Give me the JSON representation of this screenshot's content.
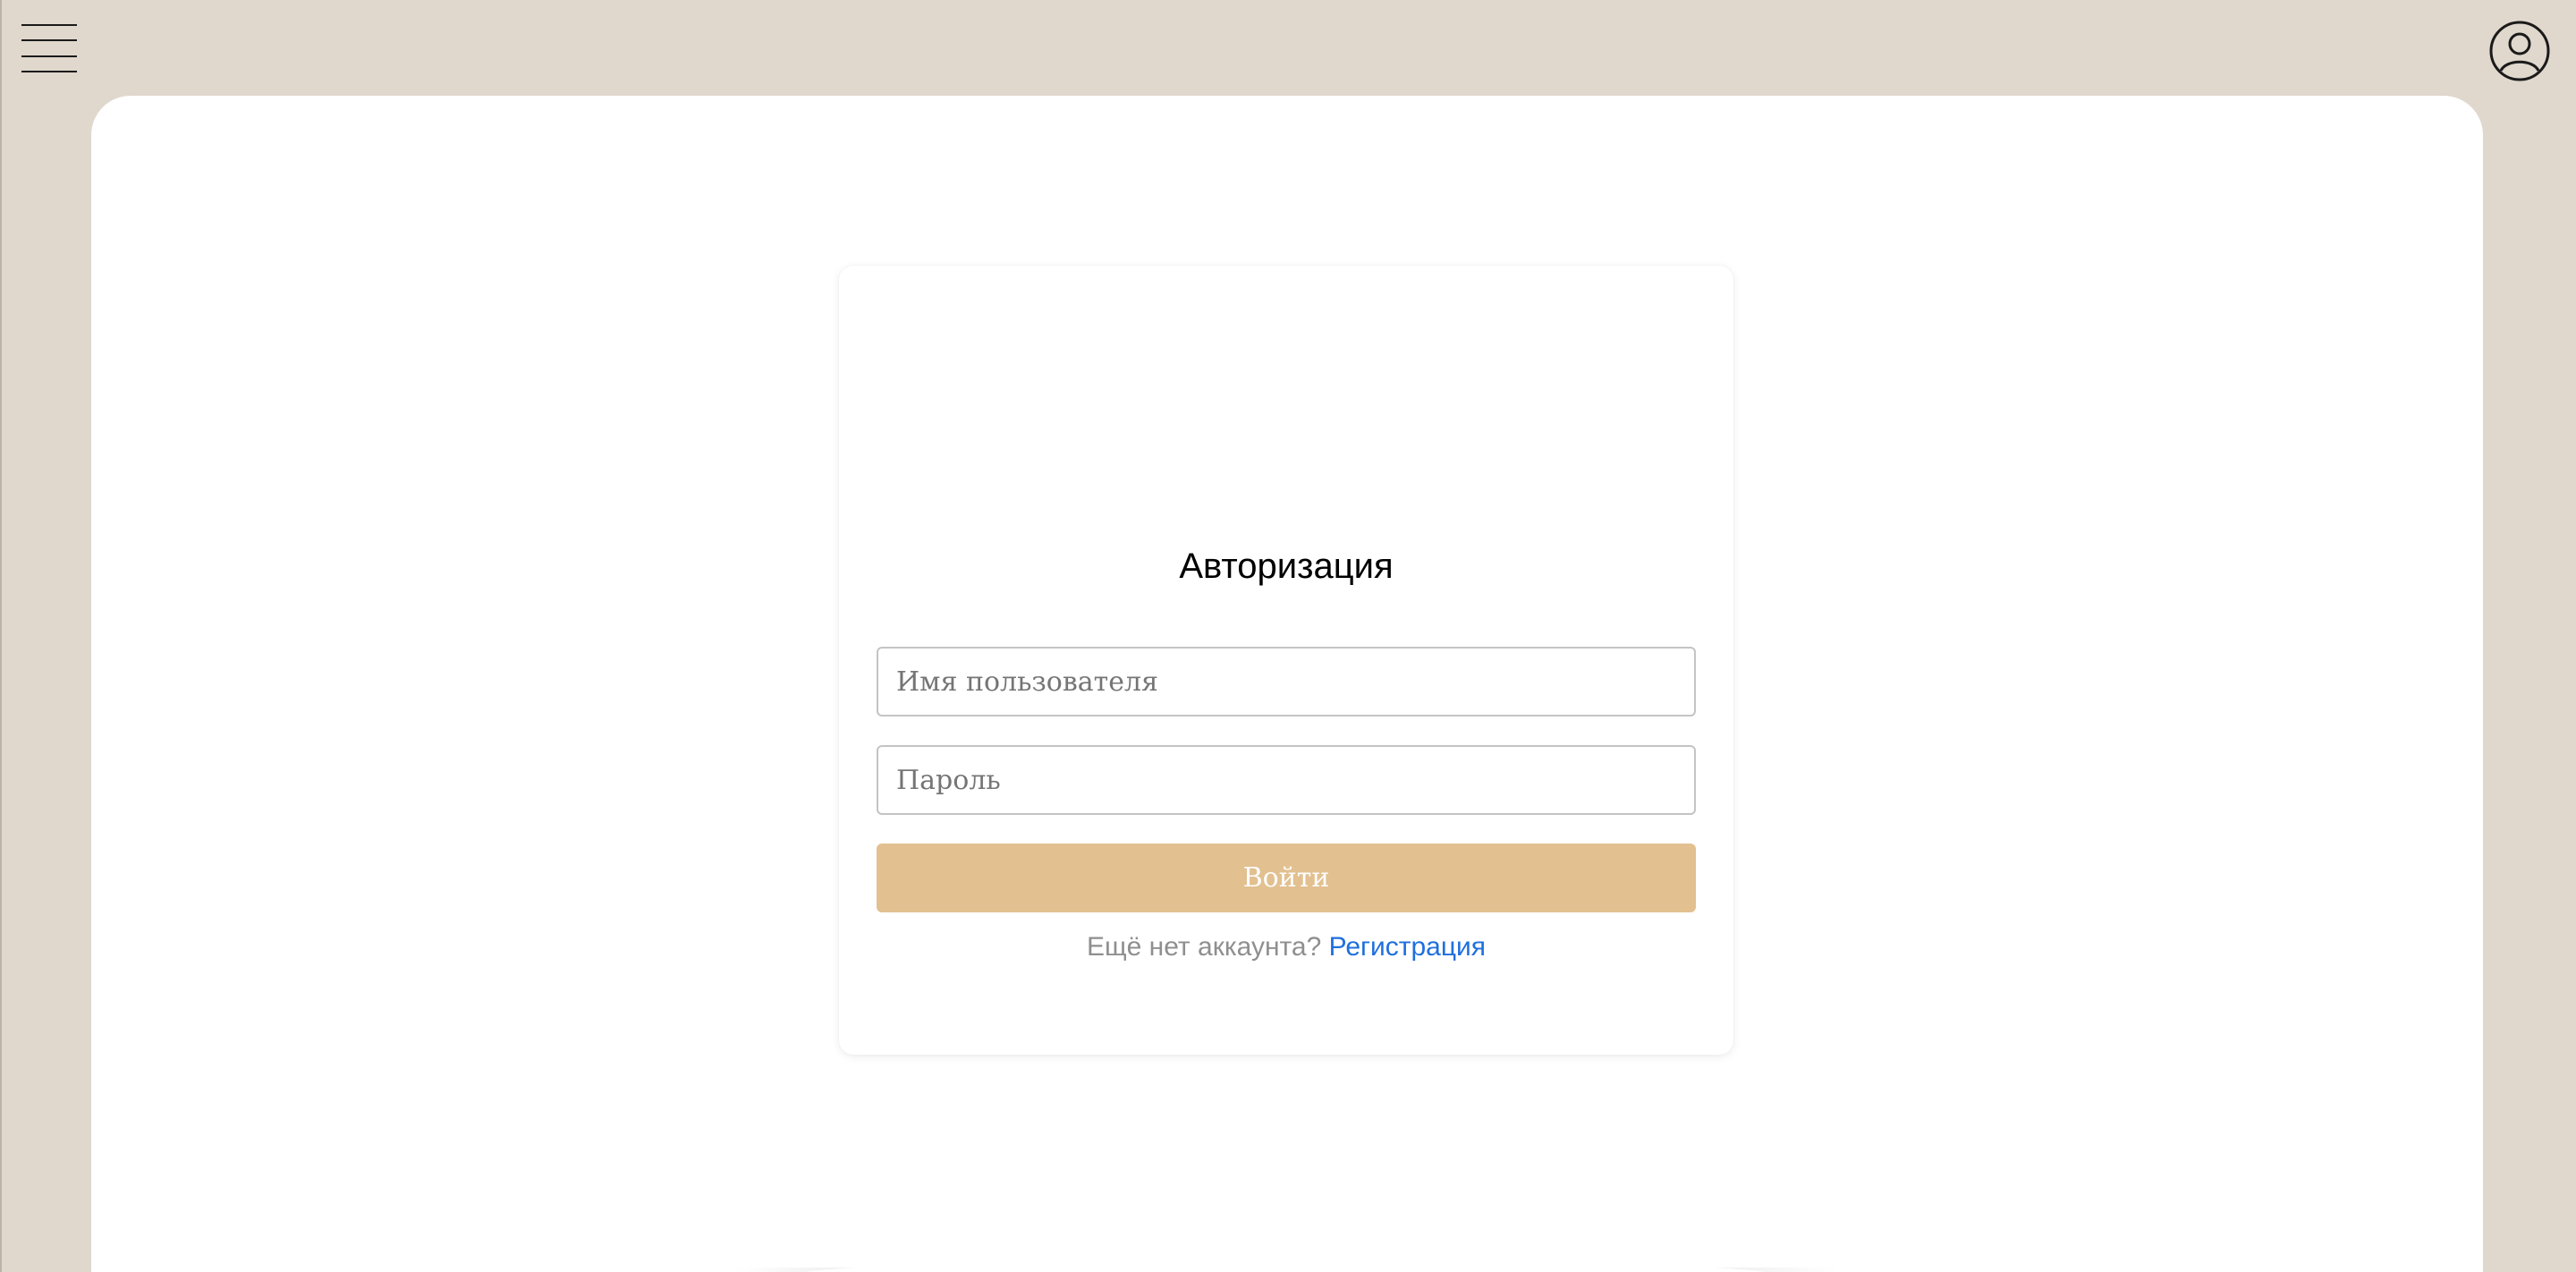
{
  "header": {
    "menu_icon": "hamburger-menu-icon",
    "profile_icon": "user-circle-icon"
  },
  "login": {
    "title": "Авторизация",
    "username_placeholder": "Имя пользователя",
    "username_value": "",
    "password_placeholder": "Пароль",
    "password_value": "",
    "submit_label": "Войти",
    "no_account_text": "Ещё нет аккаунта?",
    "register_link": "Регистрация"
  },
  "colors": {
    "page_background": "#e0d7cd",
    "panel_background": "#ffffff",
    "button_background": "#e2c090",
    "button_text": "#ffffff",
    "link": "#1f6fde",
    "muted_text": "#8f8f8f"
  }
}
